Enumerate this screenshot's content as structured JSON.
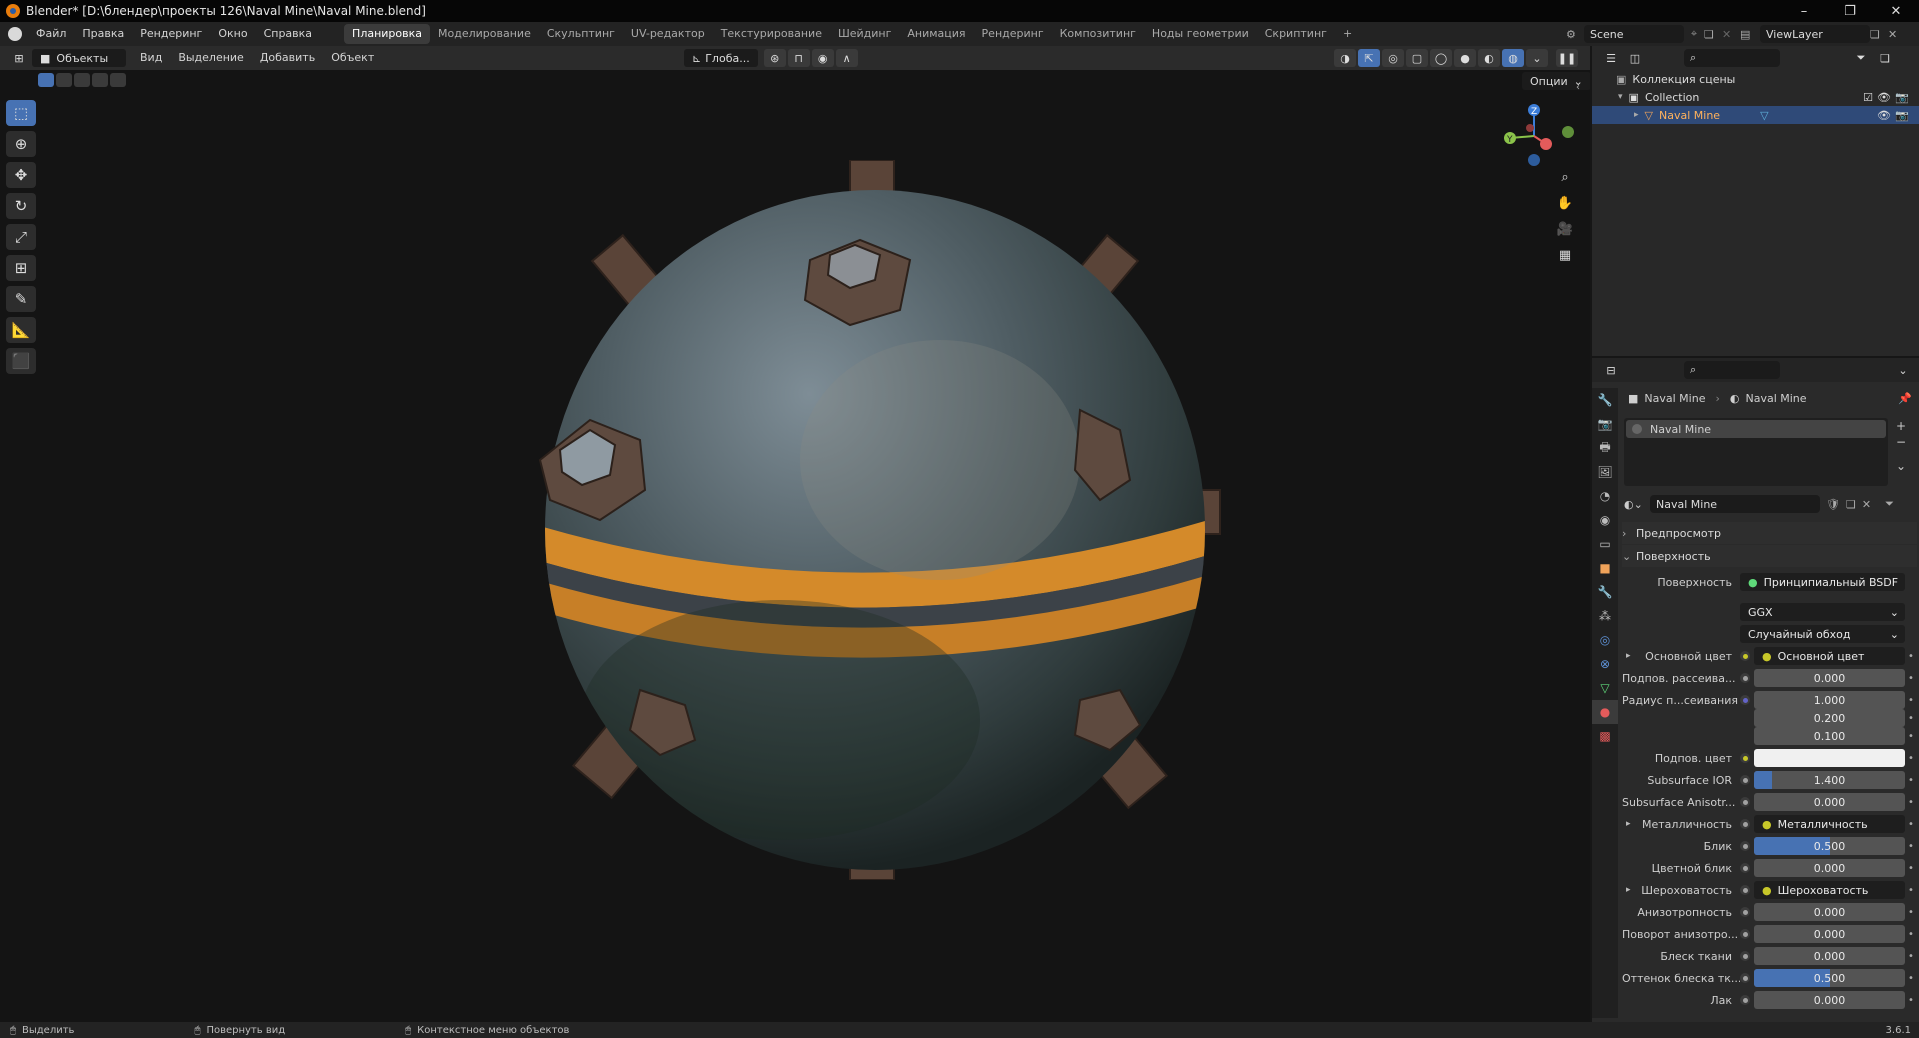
{
  "window": {
    "title": "Blender* [D:\\блендер\\проекты 126\\Naval Mine\\Naval Mine.blend]",
    "controls": [
      "–",
      "❐",
      "✕"
    ]
  },
  "menu": [
    "Файл",
    "Правка",
    "Рендеринг",
    "Окно",
    "Справка"
  ],
  "workspaces": [
    "Планировка",
    "Моделирование",
    "Скульптинг",
    "UV-редактор",
    "Текстурирование",
    "Шейдинг",
    "Анимация",
    "Рендеринг",
    "Композитинг",
    "Ноды геометрии",
    "Скриптинг"
  ],
  "active_workspace": "Планировка",
  "scene": {
    "name": "Scene",
    "view_layer": "ViewLayer"
  },
  "viewport_header": {
    "mode": "Объекты",
    "menus": [
      "Вид",
      "Выделение",
      "Добавить",
      "Объект"
    ],
    "orientation": "Глоба...",
    "options": "Опции"
  },
  "outliner": {
    "root": "Коллекция сцены",
    "collection": "Collection",
    "object": "Naval Mine"
  },
  "properties": {
    "breadcrumb_object": "Naval Mine",
    "breadcrumb_material": "Naval Mine",
    "material_slot": "Naval Mine",
    "material_name": "Naval Mine",
    "sections": {
      "preview": "Предпросмотр",
      "surface": "Поверхность"
    },
    "surface_label": "Поверхность",
    "surface_value": "Принципиальный BSDF",
    "distribution": "GGX",
    "subsurface_method": "Случайный обход",
    "rows": [
      {
        "label": "Основной цвет",
        "value": "Основной цвет",
        "kind": "link",
        "socket": "yellow",
        "expand": "▸"
      },
      {
        "label": "Подпов. рассеива...",
        "value": "0.000",
        "kind": "num",
        "socket": "gray",
        "fill": 0
      },
      {
        "label": "Радиус п...сеивания",
        "value": "1.000",
        "kind": "num",
        "socket": "blue",
        "fill": 0
      },
      {
        "label": "",
        "value": "0.200",
        "kind": "num",
        "socket": "none",
        "fill": 0
      },
      {
        "label": "",
        "value": "0.100",
        "kind": "num",
        "socket": "none",
        "fill": 0
      },
      {
        "label": "Подпов. цвет",
        "value": "",
        "kind": "color",
        "socket": "yellow",
        "color": "#f0f0f0"
      },
      {
        "label": "Subsurface IOR",
        "value": "1.400",
        "kind": "num",
        "socket": "gray",
        "fill": 0.12
      },
      {
        "label": "Subsurface Anisotr...",
        "value": "0.000",
        "kind": "num",
        "socket": "gray",
        "fill": 0
      },
      {
        "label": "Металличность",
        "value": "Металличность",
        "kind": "link",
        "socket": "gray",
        "expand": "▸"
      },
      {
        "label": "Блик",
        "value": "0.500",
        "kind": "num",
        "socket": "gray",
        "fill": 0.5
      },
      {
        "label": "Цветной блик",
        "value": "0.000",
        "kind": "num",
        "socket": "gray",
        "fill": 0
      },
      {
        "label": "Шероховатость",
        "value": "Шероховатость",
        "kind": "link",
        "socket": "gray",
        "expand": "▸"
      },
      {
        "label": "Анизотропность",
        "value": "0.000",
        "kind": "num",
        "socket": "gray",
        "fill": 0
      },
      {
        "label": "Поворот анизотро...",
        "value": "0.000",
        "kind": "num",
        "socket": "gray",
        "fill": 0
      },
      {
        "label": "Блеск ткани",
        "value": "0.000",
        "kind": "num",
        "socket": "gray",
        "fill": 0
      },
      {
        "label": "Оттенок блеска тк...",
        "value": "0.500",
        "kind": "num",
        "socket": "gray",
        "fill": 0.5
      },
      {
        "label": "Лак",
        "value": "0.000",
        "kind": "num",
        "socket": "gray",
        "fill": 0
      }
    ]
  },
  "statusbar": {
    "select": "Выделить",
    "rotate": "Повернуть вид",
    "context": "Контекстное меню объектов",
    "version": "3.6.1"
  },
  "colors": {
    "accent": "#4772b3",
    "selection": "#2f4a78",
    "stripe": "#d48a2a"
  }
}
